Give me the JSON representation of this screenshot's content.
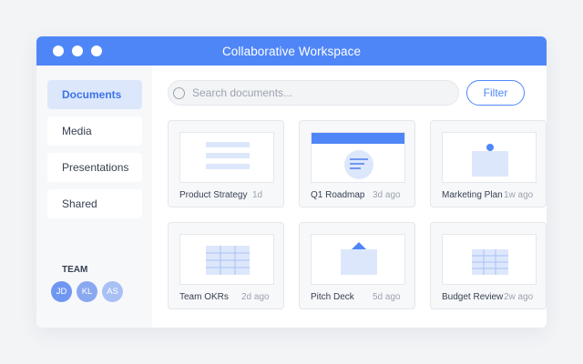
{
  "window": {
    "title": "Collaborative Workspace"
  },
  "sidebar": {
    "items": [
      {
        "label": "Documents",
        "active": true
      },
      {
        "label": "Media"
      },
      {
        "label": "Presentations"
      },
      {
        "label": "Shared"
      }
    ],
    "team_label": "TEAM",
    "team": [
      {
        "initials": "JD",
        "color": "#6f97f2"
      },
      {
        "initials": "KL",
        "color": "#8aa8f0"
      },
      {
        "initials": "AS",
        "color": "#a9c0f5"
      }
    ]
  },
  "search": {
    "placeholder": "Search documents..."
  },
  "toolbar": {
    "filter_label": "Filter"
  },
  "documents": [
    {
      "name": "Product Strategy",
      "time": "1d",
      "thumbnail": "doc-lines-icon"
    },
    {
      "name": "Q1 Roadmap",
      "time": "3d ago",
      "thumbnail": "roadmap-icon"
    },
    {
      "name": "Marketing Plan",
      "time": "1w ago",
      "thumbnail": "pinned-note-icon"
    },
    {
      "name": "Team OKRs",
      "time": "2d ago",
      "thumbnail": "table-icon"
    },
    {
      "name": "Pitch Deck",
      "time": "5d ago",
      "thumbnail": "slides-icon"
    },
    {
      "name": "Budget Review",
      "time": "2w ago",
      "thumbnail": "spreadsheet-icon"
    }
  ],
  "colors": {
    "accent": "#4f86f7",
    "soft_accent": "#dde7fc"
  }
}
